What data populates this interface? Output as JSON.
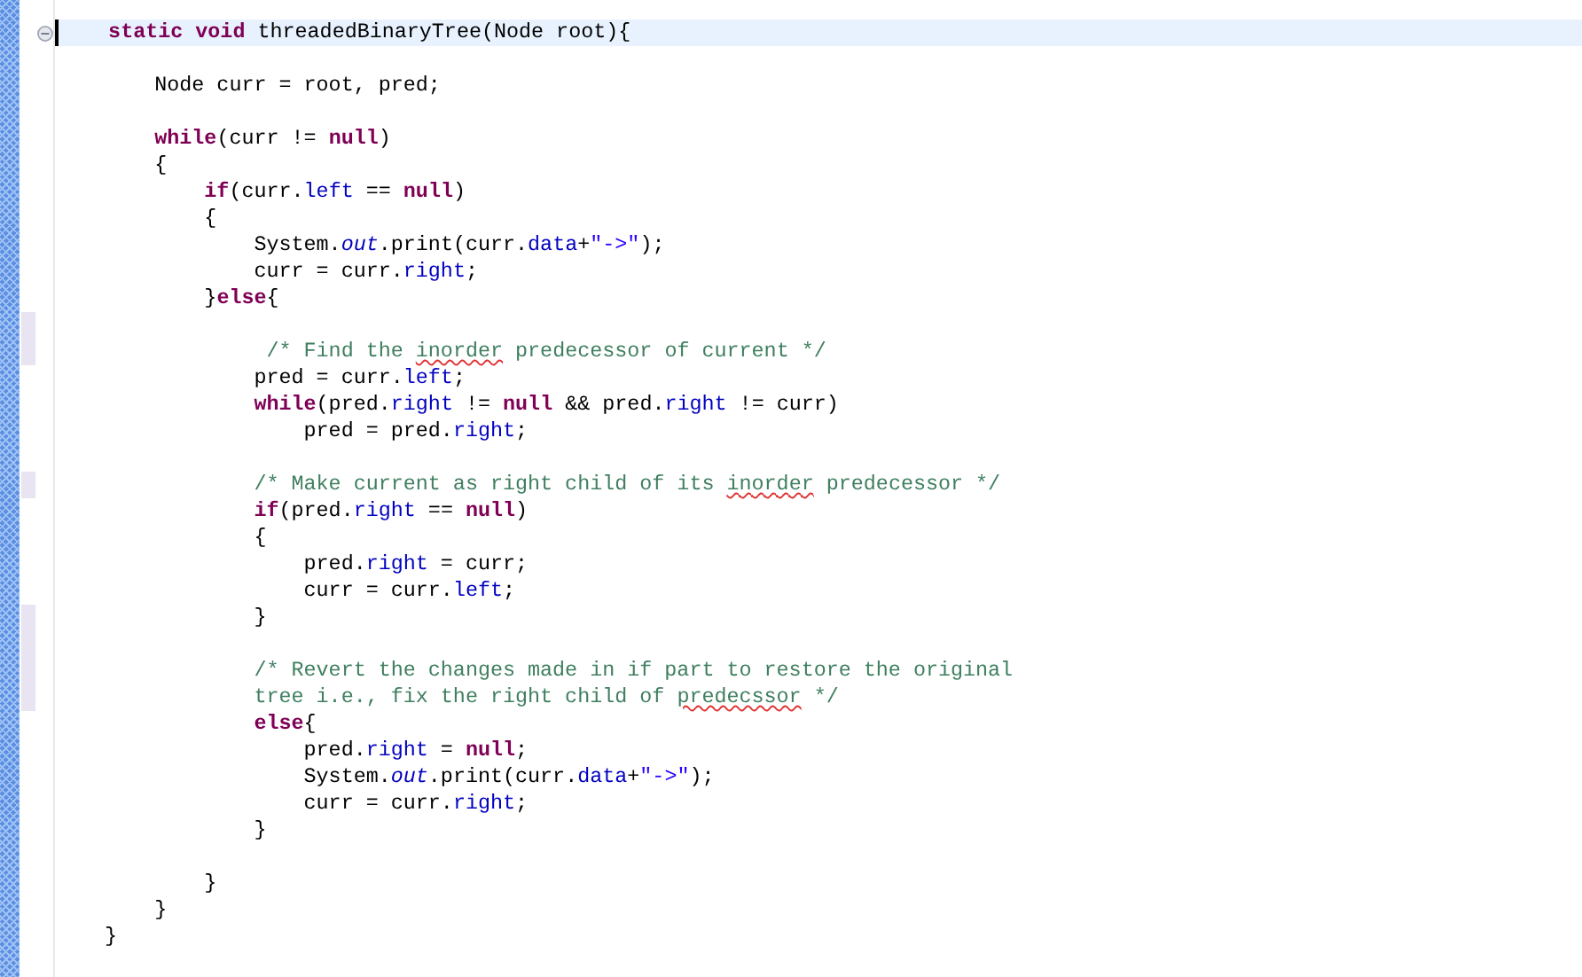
{
  "editor": {
    "lines": [
      {
        "current": true,
        "expanded": true,
        "changed": false,
        "tokens": [
          {
            "kind": "keyword",
            "text": "    static void"
          },
          {
            "kind": "plain",
            "text": " threadedBinaryTree(Node root){"
          }
        ]
      },
      {
        "current": false,
        "changed": false
      },
      {
        "current": false,
        "changed": false,
        "tokens": [
          {
            "kind": "plain",
            "text": "        Node curr = root, pred;"
          }
        ]
      },
      {
        "current": false,
        "changed": false
      },
      {
        "current": false,
        "changed": false,
        "tokens": [
          {
            "kind": "keyword",
            "text": "        while"
          },
          {
            "kind": "plain",
            "text": "(curr != "
          },
          {
            "kind": "keyword",
            "text": "null"
          },
          {
            "kind": "plain",
            "text": ")"
          }
        ]
      },
      {
        "current": false,
        "changed": false,
        "tokens": [
          {
            "kind": "plain",
            "text": "        {"
          }
        ]
      },
      {
        "current": false,
        "changed": false,
        "tokens": [
          {
            "kind": "keyword",
            "text": "            if"
          },
          {
            "kind": "plain",
            "text": "(curr."
          },
          {
            "kind": "field",
            "text": "left"
          },
          {
            "kind": "plain",
            "text": " == "
          },
          {
            "kind": "keyword",
            "text": "null"
          },
          {
            "kind": "plain",
            "text": ")"
          }
        ]
      },
      {
        "current": false,
        "changed": false,
        "tokens": [
          {
            "kind": "plain",
            "text": "            {"
          }
        ]
      },
      {
        "current": false,
        "changed": false,
        "tokens": [
          {
            "kind": "plain",
            "text": "                System."
          },
          {
            "kind": "static",
            "text": "out"
          },
          {
            "kind": "plain",
            "text": ".print(curr."
          },
          {
            "kind": "field",
            "text": "data"
          },
          {
            "kind": "plain",
            "text": "+"
          },
          {
            "kind": "string",
            "text": "\"->\""
          },
          {
            "kind": "plain",
            "text": ");"
          }
        ]
      },
      {
        "current": false,
        "changed": false,
        "tokens": [
          {
            "kind": "plain",
            "text": "                curr = curr."
          },
          {
            "kind": "field",
            "text": "right"
          },
          {
            "kind": "plain",
            "text": ";"
          }
        ]
      },
      {
        "current": false,
        "changed": false,
        "tokens": [
          {
            "kind": "plain",
            "text": "            }"
          },
          {
            "kind": "keyword",
            "text": "else"
          },
          {
            "kind": "plain",
            "text": "{"
          }
        ]
      },
      {
        "current": false,
        "changed": true
      },
      {
        "current": false,
        "changed": true,
        "tokens": [
          {
            "kind": "comment",
            "text": "                 /* Find the "
          },
          {
            "kind": "misspelled",
            "text": "inorder"
          },
          {
            "kind": "comment",
            "text": " predecessor of current */"
          }
        ]
      },
      {
        "current": false,
        "changed": false,
        "tokens": [
          {
            "kind": "plain",
            "text": "                pred = curr."
          },
          {
            "kind": "field",
            "text": "left"
          },
          {
            "kind": "plain",
            "text": ";"
          }
        ]
      },
      {
        "current": false,
        "changed": false,
        "tokens": [
          {
            "kind": "keyword",
            "text": "                while"
          },
          {
            "kind": "plain",
            "text": "(pred."
          },
          {
            "kind": "field",
            "text": "right"
          },
          {
            "kind": "plain",
            "text": " != "
          },
          {
            "kind": "keyword",
            "text": "null"
          },
          {
            "kind": "plain",
            "text": " && pred."
          },
          {
            "kind": "field",
            "text": "right"
          },
          {
            "kind": "plain",
            "text": " != curr)"
          }
        ]
      },
      {
        "current": false,
        "changed": false,
        "tokens": [
          {
            "kind": "plain",
            "text": "                    pred = pred."
          },
          {
            "kind": "field",
            "text": "right"
          },
          {
            "kind": "plain",
            "text": ";"
          }
        ]
      },
      {
        "current": false,
        "changed": false
      },
      {
        "current": false,
        "changed": true,
        "tokens": [
          {
            "kind": "comment",
            "text": "                /* Make current as right child of its "
          },
          {
            "kind": "misspelled",
            "text": "inorder"
          },
          {
            "kind": "comment",
            "text": " predecessor */"
          }
        ]
      },
      {
        "current": false,
        "changed": false,
        "tokens": [
          {
            "kind": "keyword",
            "text": "                if"
          },
          {
            "kind": "plain",
            "text": "(pred."
          },
          {
            "kind": "field",
            "text": "right"
          },
          {
            "kind": "plain",
            "text": " == "
          },
          {
            "kind": "keyword",
            "text": "null"
          },
          {
            "kind": "plain",
            "text": ")"
          }
        ]
      },
      {
        "current": false,
        "changed": false,
        "tokens": [
          {
            "kind": "plain",
            "text": "                {"
          }
        ]
      },
      {
        "current": false,
        "changed": false,
        "tokens": [
          {
            "kind": "plain",
            "text": "                    pred."
          },
          {
            "kind": "field",
            "text": "right"
          },
          {
            "kind": "plain",
            "text": " = curr;"
          }
        ]
      },
      {
        "current": false,
        "changed": false,
        "tokens": [
          {
            "kind": "plain",
            "text": "                    curr = curr."
          },
          {
            "kind": "field",
            "text": "left"
          },
          {
            "kind": "plain",
            "text": ";"
          }
        ]
      },
      {
        "current": false,
        "changed": true,
        "tokens": [
          {
            "kind": "plain",
            "text": "                }"
          }
        ]
      },
      {
        "current": false,
        "changed": true
      },
      {
        "current": false,
        "changed": true,
        "tokens": [
          {
            "kind": "comment",
            "text": "                /* Revert the changes made in if part to restore the original"
          }
        ]
      },
      {
        "current": false,
        "changed": true,
        "tokens": [
          {
            "kind": "comment",
            "text": "                tree i.e., fix the right child of "
          },
          {
            "kind": "misspelled",
            "text": "predecssor"
          },
          {
            "kind": "comment",
            "text": " */"
          }
        ]
      },
      {
        "current": false,
        "changed": false,
        "tokens": [
          {
            "kind": "keyword",
            "text": "                else"
          },
          {
            "kind": "plain",
            "text": "{"
          }
        ]
      },
      {
        "current": false,
        "changed": false,
        "tokens": [
          {
            "kind": "plain",
            "text": "                    pred."
          },
          {
            "kind": "field",
            "text": "right"
          },
          {
            "kind": "plain",
            "text": " = "
          },
          {
            "kind": "keyword",
            "text": "null"
          },
          {
            "kind": "plain",
            "text": ";"
          }
        ]
      },
      {
        "current": false,
        "changed": false,
        "tokens": [
          {
            "kind": "plain",
            "text": "                    System."
          },
          {
            "kind": "static",
            "text": "out"
          },
          {
            "kind": "plain",
            "text": ".print(curr."
          },
          {
            "kind": "field",
            "text": "data"
          },
          {
            "kind": "plain",
            "text": "+"
          },
          {
            "kind": "string",
            "text": "\"->\""
          },
          {
            "kind": "plain",
            "text": ");"
          }
        ]
      },
      {
        "current": false,
        "changed": false,
        "tokens": [
          {
            "kind": "plain",
            "text": "                    curr = curr."
          },
          {
            "kind": "field",
            "text": "right"
          },
          {
            "kind": "plain",
            "text": ";"
          }
        ]
      },
      {
        "current": false,
        "changed": false,
        "tokens": [
          {
            "kind": "plain",
            "text": "                }"
          }
        ]
      },
      {
        "current": false,
        "changed": false
      },
      {
        "current": false,
        "changed": false,
        "tokens": [
          {
            "kind": "plain",
            "text": "            }"
          }
        ]
      },
      {
        "current": false,
        "changed": false,
        "tokens": [
          {
            "kind": "plain",
            "text": "        }"
          }
        ]
      },
      {
        "current": false,
        "changed": false,
        "tokens": [
          {
            "kind": "plain",
            "text": "    }"
          }
        ]
      }
    ]
  }
}
